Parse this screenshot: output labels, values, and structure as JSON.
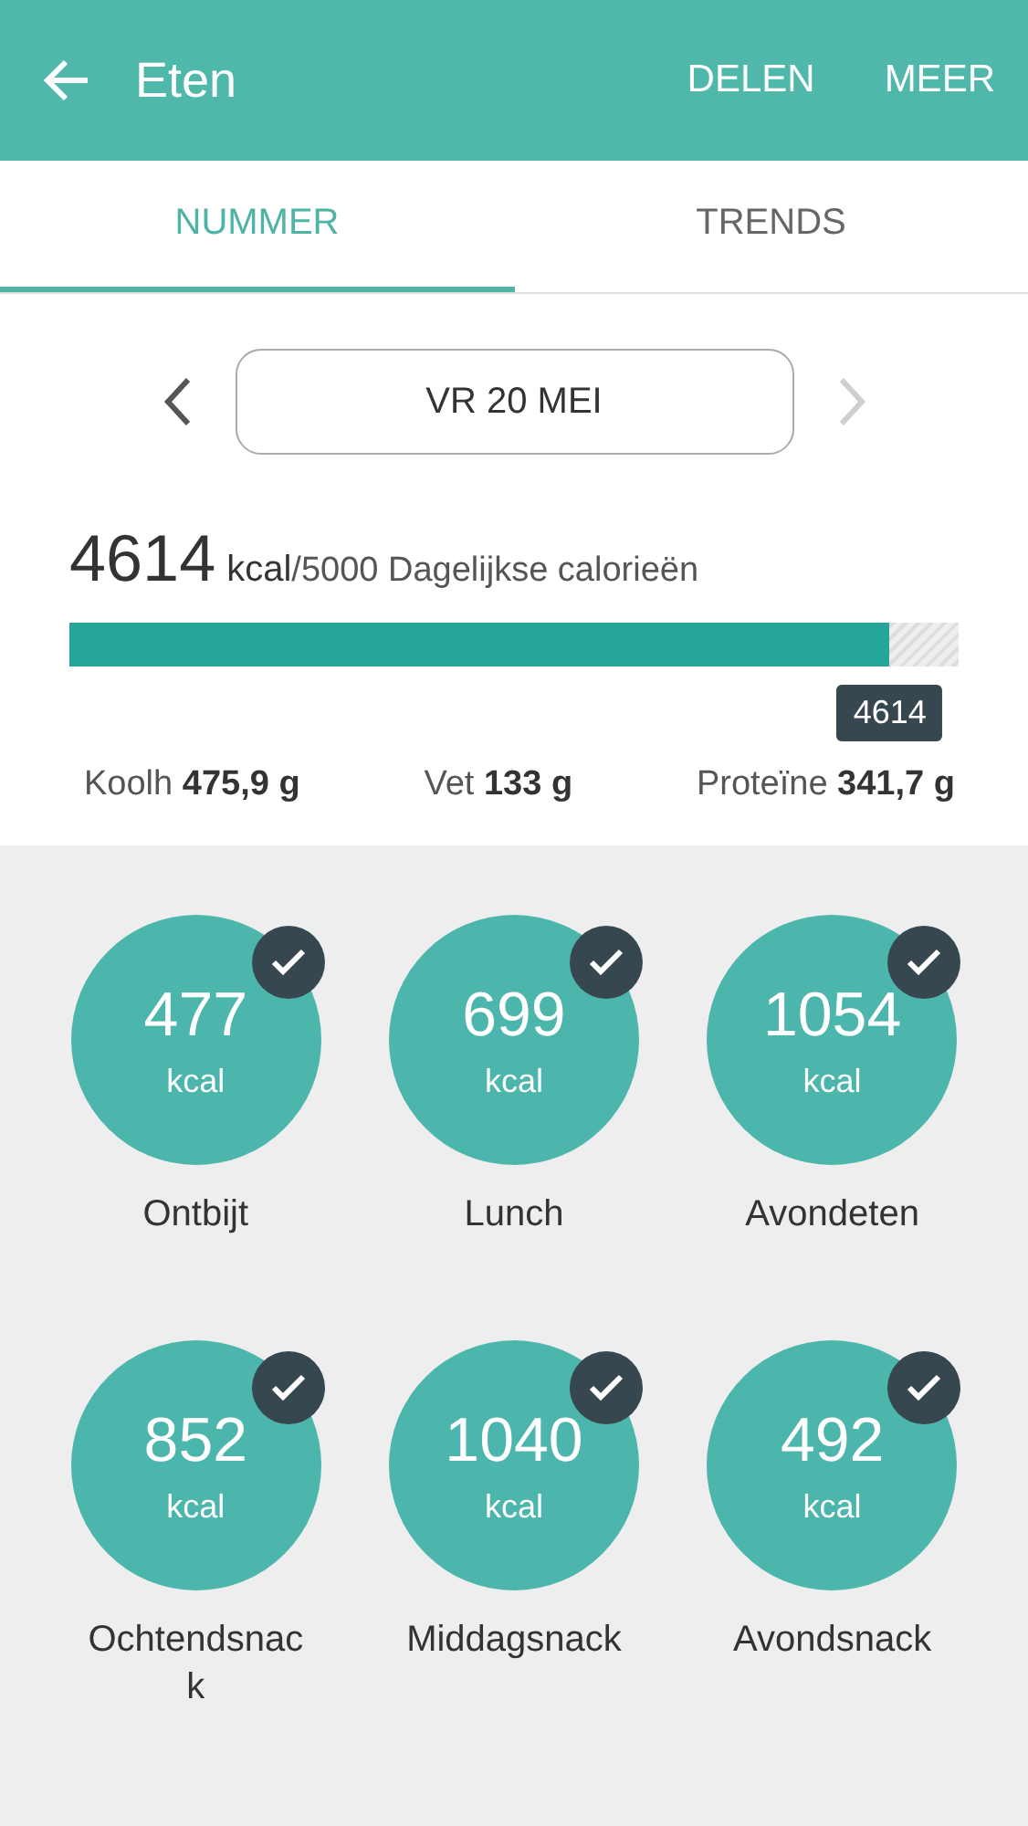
{
  "header": {
    "title": "Eten",
    "actions": [
      "DELEN",
      "MEER"
    ]
  },
  "tabs": [
    {
      "label": "NUMMER",
      "selected": true
    },
    {
      "label": "TRENDS",
      "selected": false
    }
  ],
  "date_nav": {
    "date": "VR 20 MEI",
    "prev_disabled": false,
    "next_disabled": true
  },
  "calories": {
    "value": "4614",
    "unit": "kcal",
    "goal": "/5000 Dagelijkse calorieën",
    "level": 0.9228,
    "tooltip": "4614"
  },
  "macros": [
    {
      "label": "Koolh",
      "value": "475,9 g"
    },
    {
      "label": "Vet",
      "value": "133 g"
    },
    {
      "label": "Proteïne",
      "value": "341,7 g"
    }
  ],
  "meals": [
    {
      "value": "477",
      "unit": "kcal",
      "name": "Ontbijt",
      "checked": true
    },
    {
      "value": "699",
      "unit": "kcal",
      "name": "Lunch",
      "checked": true
    },
    {
      "value": "1054",
      "unit": "kcal",
      "name": "Avondeten",
      "checked": true
    },
    {
      "value": "852",
      "unit": "kcal",
      "name": "Ochtendsnack",
      "checked": true
    },
    {
      "value": "1040",
      "unit": "kcal",
      "name": "Middagsnack",
      "checked": true
    },
    {
      "value": "492",
      "unit": "kcal",
      "name": "Avondsnack",
      "checked": true
    }
  ]
}
